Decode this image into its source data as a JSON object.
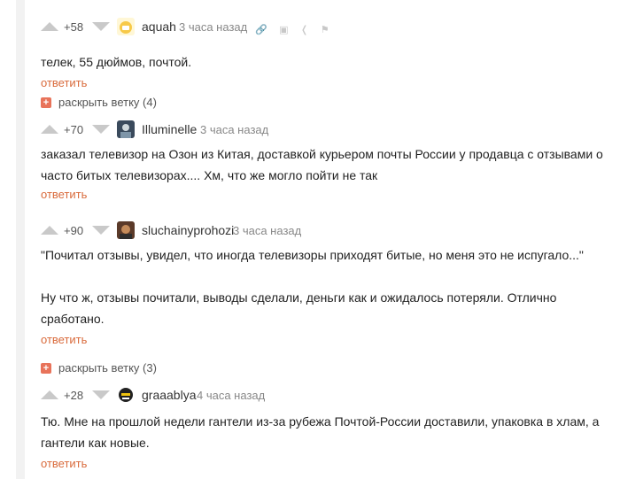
{
  "comments": [
    {
      "rating": "+58",
      "username": "aquah",
      "time": "3 часа назад",
      "text": "телек, 55 дюймов, почтой.",
      "reply": "ответить"
    },
    {
      "rating": "+70",
      "username": "Illuminelle",
      "time": "3 часа назад",
      "text": "заказал телевизор на Озон из Китая, доставкой курьером почты России у продавца с отзывами о часто битых телевизорах.... Хм, что же могло пойти не так",
      "reply": "ответить"
    },
    {
      "rating": "+90",
      "username": "sluchainyprohozi",
      "time": "3 часа назад",
      "text_p1": "\"Почитал отзывы, увидел, что иногда телевизоры приходят битые, но меня это не испугало...\"",
      "text_p2": "Ну что ж, отзывы почитали, выводы сделали, деньги как и ожидалось потеряли. Отлично сработано.",
      "reply": "ответить"
    },
    {
      "rating": "+28",
      "username": "graaablya",
      "time": "4 часа назад",
      "text": "Тю. Мне на прошлой недели гантели из-за рубежа Почтой-России доставили, упаковка в хлам, а гантели как новые.",
      "reply": "ответить"
    }
  ],
  "branches": [
    {
      "label": "раскрыть ветку (4)"
    },
    {
      "label": "раскрыть ветку (3)"
    }
  ],
  "icons": [
    "link-icon",
    "save-icon",
    "share-icon",
    "flag-icon"
  ],
  "colors": {
    "accent": "#d96a3b",
    "plus_box": "#e8735a",
    "vote_arrow": "#c9c9c9"
  }
}
